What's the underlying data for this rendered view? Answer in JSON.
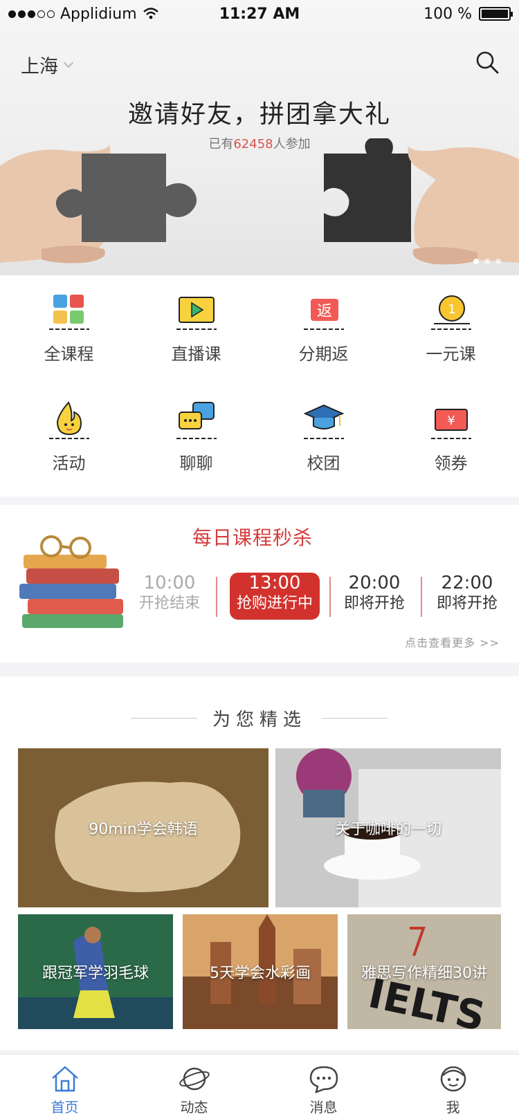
{
  "status_bar": {
    "carrier": "Applidium",
    "time": "11:27 AM",
    "battery": "100 %",
    "battery_level_percent": 100
  },
  "header": {
    "city": "上海",
    "search_icon": "search-icon"
  },
  "banner": {
    "title": "邀请好友，拼团拿大礼",
    "subtitle_prefix": "已有",
    "subtitle_count": "62458",
    "subtitle_suffix": "人参加",
    "accent_color": "#d9534f"
  },
  "categories": [
    {
      "label": "全课程",
      "icon": "grid-squares-icon"
    },
    {
      "label": "直播课",
      "icon": "live-play-icon"
    },
    {
      "label": "分期返",
      "icon": "installment-return-icon"
    },
    {
      "label": "一元课",
      "icon": "one-yuan-coin-icon"
    },
    {
      "label": "活动",
      "icon": "flame-mascot-icon"
    },
    {
      "label": "聊聊",
      "icon": "chat-bubbles-icon"
    },
    {
      "label": "校团",
      "icon": "graduation-cap-icon"
    },
    {
      "label": "领券",
      "icon": "coupon-ticket-icon"
    }
  ],
  "seckill": {
    "title": "每日课程秒杀",
    "slots": [
      {
        "time": "10:00",
        "status": "开抢结束",
        "state": "past"
      },
      {
        "time": "13:00",
        "status": "抢购进行中",
        "state": "active"
      },
      {
        "time": "20:00",
        "status": "即将开抢",
        "state": "future"
      },
      {
        "time": "22:00",
        "status": "即将开抢",
        "state": "future"
      }
    ],
    "more": "点击查看更多 >>",
    "active_color": "#d2322d"
  },
  "featured": {
    "title": "为您精选",
    "cards": [
      {
        "label": "90min学会韩语"
      },
      {
        "label": "关于咖啡的一切"
      },
      {
        "label": "跟冠军学羽毛球"
      },
      {
        "label": "5天学会水彩画"
      },
      {
        "label": "雅思写作精细30讲"
      }
    ]
  },
  "tabbar": {
    "active_color": "#3a7bd5",
    "tabs": [
      {
        "label": "首页",
        "icon": "home-icon"
      },
      {
        "label": "动态",
        "icon": "planet-icon"
      },
      {
        "label": "消息",
        "icon": "message-bubble-icon"
      },
      {
        "label": "我",
        "icon": "profile-face-icon"
      }
    ]
  }
}
